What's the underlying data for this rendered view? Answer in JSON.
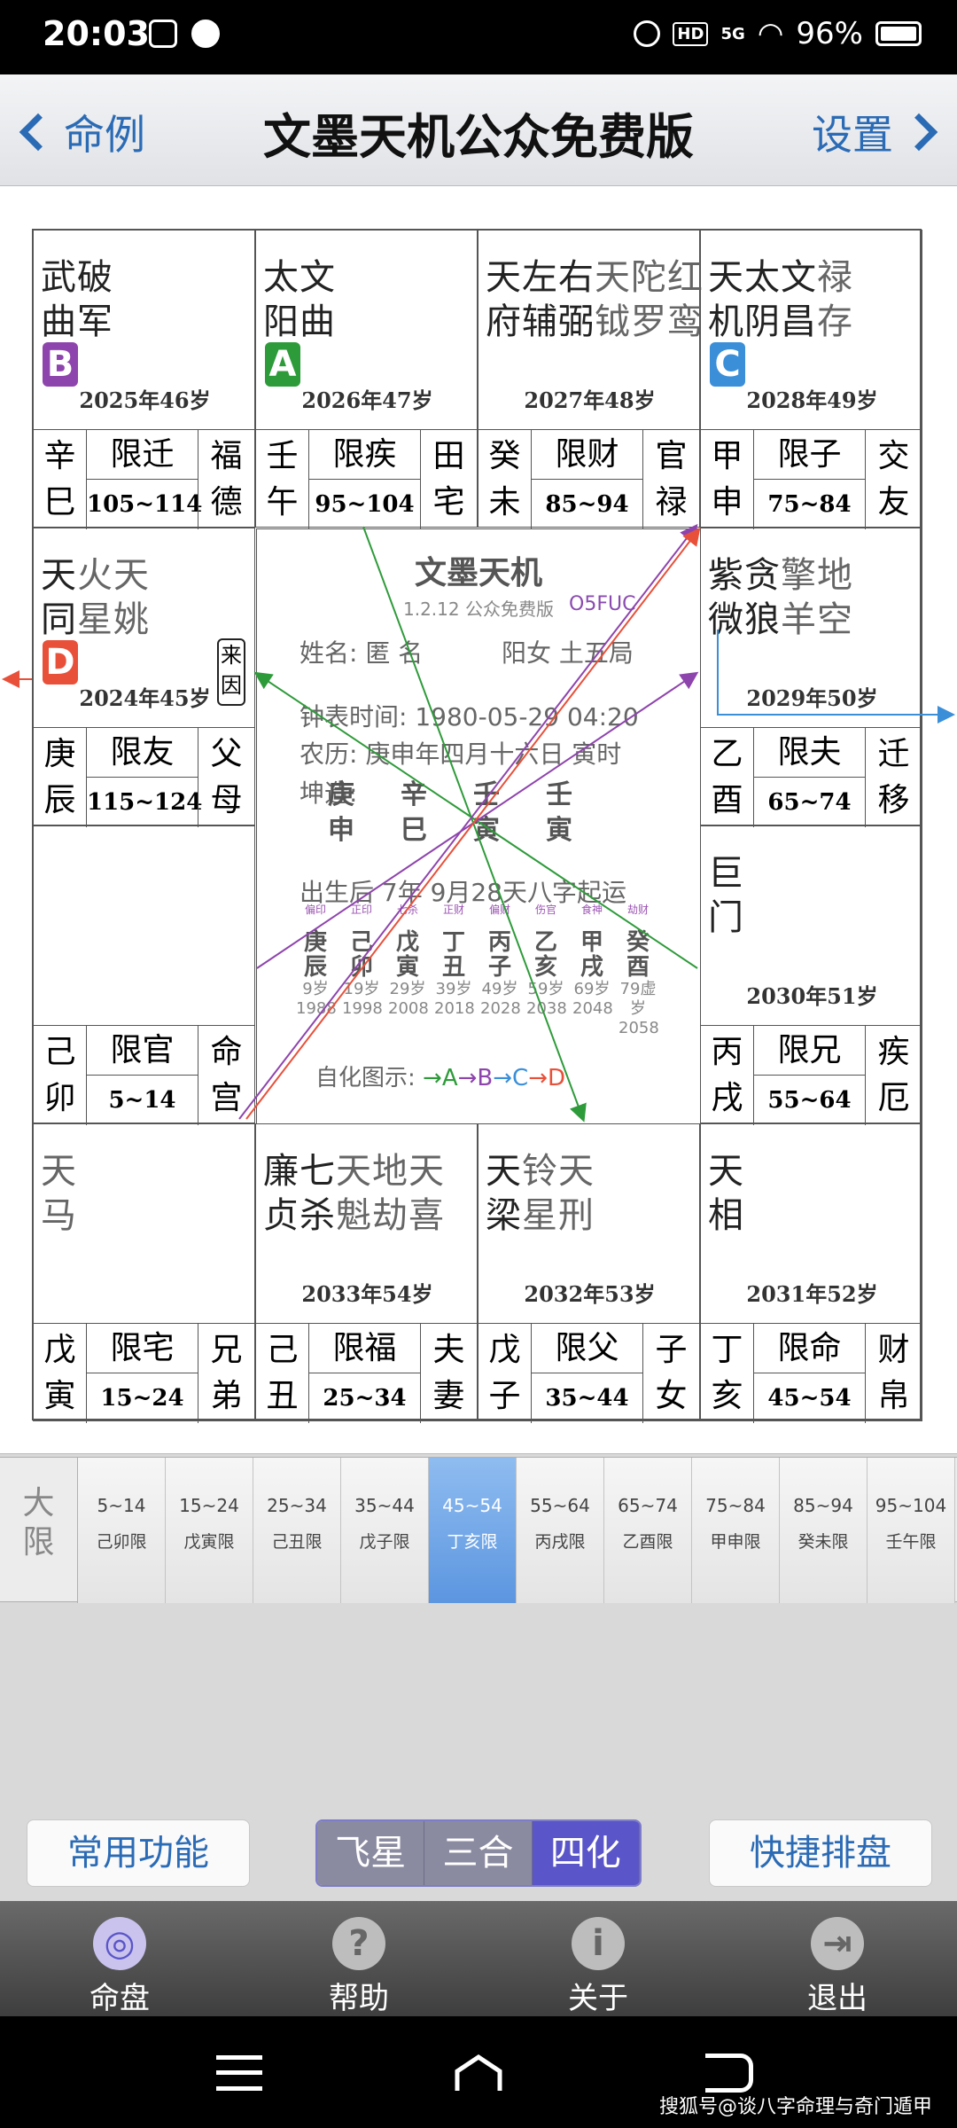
{
  "status": {
    "time": "20:03",
    "network": "5G",
    "hd": "HD",
    "battery": "96%"
  },
  "header": {
    "back_label": "命例",
    "title": "文墨天机公众免费版",
    "settings_label": "设置"
  },
  "palaces": [
    {
      "id": "si",
      "stars": [
        {
          "t": "武",
          "m": 1
        },
        {
          "t": "曲",
          "m": 1
        },
        {
          "t": "破",
          "m": 1
        },
        {
          "t": "军",
          "m": 1
        }
      ],
      "row1": "武破",
      "row2": "曲军",
      "row1_minor": "",
      "row2_minor": "",
      "hua": "B",
      "year": "2025年46岁",
      "gz1": "辛",
      "gz2": "巳",
      "xian": "限迁",
      "age": "105~114",
      "gong1": "福",
      "gong2": "德"
    },
    {
      "id": "wu",
      "row1": "太文",
      "row2": "阳曲",
      "row1_minor": "",
      "row2_minor": "",
      "hua": "A",
      "year": "2026年47岁",
      "gz1": "壬",
      "gz2": "午",
      "xian": "限疾",
      "age": "95~104",
      "gong1": "田",
      "gong2": "宅"
    },
    {
      "id": "wei",
      "row1": "天左右",
      "row2": "府辅弼",
      "row1_minor": "天陀红",
      "row2_minor": "钺罗鸾",
      "year": "2027年48岁",
      "gz1": "癸",
      "gz2": "未",
      "xian": "限财",
      "age": "85~94",
      "gong1": "官",
      "gong2": "禄"
    },
    {
      "id": "shen",
      "row1": "天太文",
      "row2": "机阴昌",
      "row1_minor": "禄",
      "row2_minor": "存",
      "hua": "C",
      "year": "2028年49岁",
      "gz1": "甲",
      "gz2": "申",
      "xian": "限子",
      "age": "75~84",
      "gong1": "交",
      "gong2": "友"
    },
    {
      "id": "chen",
      "row1": "天",
      "row2": "同",
      "row1_minor": "火天",
      "row2_minor": "星姚",
      "hua": "D",
      "laiyin": "来因",
      "year": "2024年45岁",
      "gz1": "庚",
      "gz2": "辰",
      "xian": "限友",
      "age": "115~124",
      "gong1": "父",
      "gong2": "母"
    },
    {
      "id": "you",
      "row1": "紫贪",
      "row2": "微狼",
      "row1_minor": "擎地",
      "row2_minor": "羊空",
      "year": "2029年50岁",
      "gz1": "乙",
      "gz2": "酉",
      "xian": "限夫",
      "age": "65~74",
      "gong1": "迁",
      "gong2": "移"
    },
    {
      "id": "mao",
      "row1": "",
      "row2": "",
      "row1_minor": "",
      "row2_minor": "",
      "year": "",
      "gz1": "己",
      "gz2": "卯",
      "xian": "限官",
      "age": "5~14",
      "gong1": "命",
      "gong2": "宫"
    },
    {
      "id": "xu",
      "row1": "巨",
      "row2": "门",
      "row1_minor": "",
      "row2_minor": "",
      "year": "2030年51岁",
      "gz1": "丙",
      "gz2": "戌",
      "xian": "限兄",
      "age": "55~64",
      "gong1": "疾",
      "gong2": "厄"
    },
    {
      "id": "yin",
      "row1": "",
      "row2": "",
      "row1_minor": "天",
      "row2_minor": "马",
      "year": "",
      "gz1": "戊",
      "gz2": "寅",
      "xian": "限宅",
      "age": "15~24",
      "gong1": "兄",
      "gong2": "弟"
    },
    {
      "id": "chou",
      "row1": "廉七",
      "row2": "贞杀",
      "row1_minor": "天地天",
      "row2_minor": "魁劫喜",
      "year": "2033年54岁",
      "gz1": "己",
      "gz2": "丑",
      "xian": "限福",
      "age": "25~34",
      "gong1": "夫",
      "gong2": "妻"
    },
    {
      "id": "zi",
      "row1": "天",
      "row2": "梁",
      "row1_minor": "铃天",
      "row2_minor": "星刑",
      "year": "2032年53岁",
      "gz1": "戊",
      "gz2": "子",
      "xian": "限父",
      "age": "35~44",
      "gong1": "子",
      "gong2": "女"
    },
    {
      "id": "hai",
      "row1": "天",
      "row2": "相",
      "row1_minor": "",
      "row2_minor": "",
      "year": "2031年52岁",
      "gz1": "丁",
      "gz2": "亥",
      "xian": "限命",
      "age": "45~54",
      "gong1": "财",
      "gong2": "帛"
    }
  ],
  "center": {
    "title": "文墨天机",
    "version": "1.2.12 公众免费版",
    "code": "O5FUC",
    "name_line": "姓名: 匿 名",
    "gender_line": "阳女 土五局",
    "clock_line": "钟表时间: 1980-05-29   04:20",
    "lunar_line": "农历: 庚申年四月十六日 寅时",
    "kun_label": "坤造:",
    "pillars_top": [
      "庚",
      "辛",
      "壬",
      "壬"
    ],
    "pillars_bottom": [
      "申",
      "巳",
      "寅",
      "寅"
    ],
    "qiyun_line": "出生后 7年 9月28天八字起运",
    "dayun": [
      {
        "ss": "偏印",
        "g": "庚",
        "z": "辰",
        "age": "9岁",
        "year": "1988"
      },
      {
        "ss": "正印",
        "g": "己",
        "z": "卯",
        "age": "19岁",
        "year": "1998"
      },
      {
        "ss": "七杀",
        "g": "戊",
        "z": "寅",
        "age": "29岁",
        "year": "2008"
      },
      {
        "ss": "正财",
        "g": "丁",
        "z": "丑",
        "age": "39岁",
        "year": "2018"
      },
      {
        "ss": "偏财",
        "g": "丙",
        "z": "子",
        "age": "49岁",
        "year": "2028"
      },
      {
        "ss": "伤官",
        "g": "乙",
        "z": "亥",
        "age": "59岁",
        "year": "2038"
      },
      {
        "ss": "食神",
        "g": "甲",
        "z": "戌",
        "age": "69岁",
        "year": "2048"
      },
      {
        "ss": "劫财",
        "g": "癸",
        "z": "酉",
        "age": "79虚岁",
        "year": "2058"
      }
    ],
    "zihua_label": "自化图示:",
    "zihua_A": "→A",
    "zihua_B": "→B",
    "zihua_C": "→C",
    "zihua_D": "→D"
  },
  "colors": {
    "A": "#2e9b3a",
    "B": "#8e44ad",
    "C": "#3a8fd8",
    "D": "#e8503a",
    "accent": "#2b6bb5"
  },
  "daxian": {
    "label1": "大",
    "label2": "限",
    "items": [
      {
        "range": "5~14",
        "name": "己卯限"
      },
      {
        "range": "15~24",
        "name": "戊寅限"
      },
      {
        "range": "25~34",
        "name": "己丑限"
      },
      {
        "range": "35~44",
        "name": "戊子限"
      },
      {
        "range": "45~54",
        "name": "丁亥限",
        "selected": true
      },
      {
        "range": "55~64",
        "name": "丙戌限"
      },
      {
        "range": "65~74",
        "name": "乙酉限"
      },
      {
        "range": "75~84",
        "name": "甲申限"
      },
      {
        "range": "85~94",
        "name": "癸未限"
      },
      {
        "range": "95~104",
        "name": "壬午限"
      }
    ]
  },
  "buttons": {
    "common": "常用功能",
    "quick": "快捷排盘",
    "seg": [
      "飞星",
      "三合",
      "四化"
    ],
    "seg_active": "四化"
  },
  "tabs": [
    {
      "label": "命盘",
      "icon": "disc-icon"
    },
    {
      "label": "帮助",
      "icon": "question-icon"
    },
    {
      "label": "关于",
      "icon": "info-icon"
    },
    {
      "label": "退出",
      "icon": "exit-icon"
    }
  ],
  "watermark": "搜狐号@谈八字命理与奇门遁甲"
}
